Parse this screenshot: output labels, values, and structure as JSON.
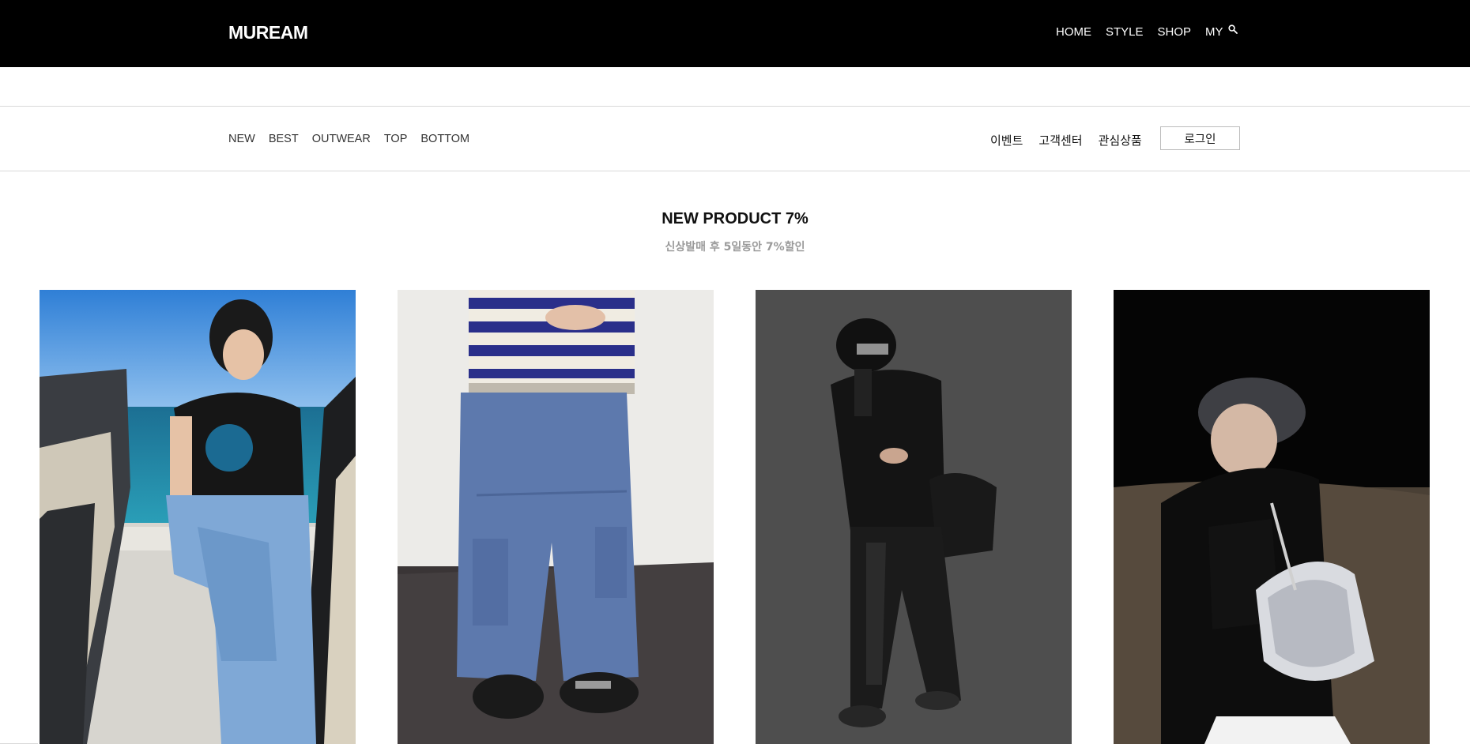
{
  "header": {
    "logo": "MUREAM",
    "nav": [
      "HOME",
      "STYLE",
      "SHOP",
      "MY"
    ],
    "search_icon": "search-icon"
  },
  "category_nav": [
    "NEW",
    "BEST",
    "OUTWEAR",
    "TOP",
    "BOTTOM"
  ],
  "utility_nav": [
    "이벤트",
    "고객센터",
    "관심상품"
  ],
  "login_label": "로그인",
  "section": {
    "title": "NEW PRODUCT 7%",
    "subtitle": "신상발매 후 5일동안 7%할인"
  },
  "products": [
    {
      "image": "product-photo-black-tee-blue-pants-by-sea"
    },
    {
      "image": "product-photo-blue-cargo-wide-pants"
    },
    {
      "image": "product-photo-black-leather-outfit-cap"
    },
    {
      "image": "product-photo-black-jacket-white-bag-night"
    }
  ],
  "colors": {
    "topbar": "#000000",
    "text": "#111111",
    "subtitle": "#9a9a9a",
    "divider": "#d9d9d9"
  }
}
